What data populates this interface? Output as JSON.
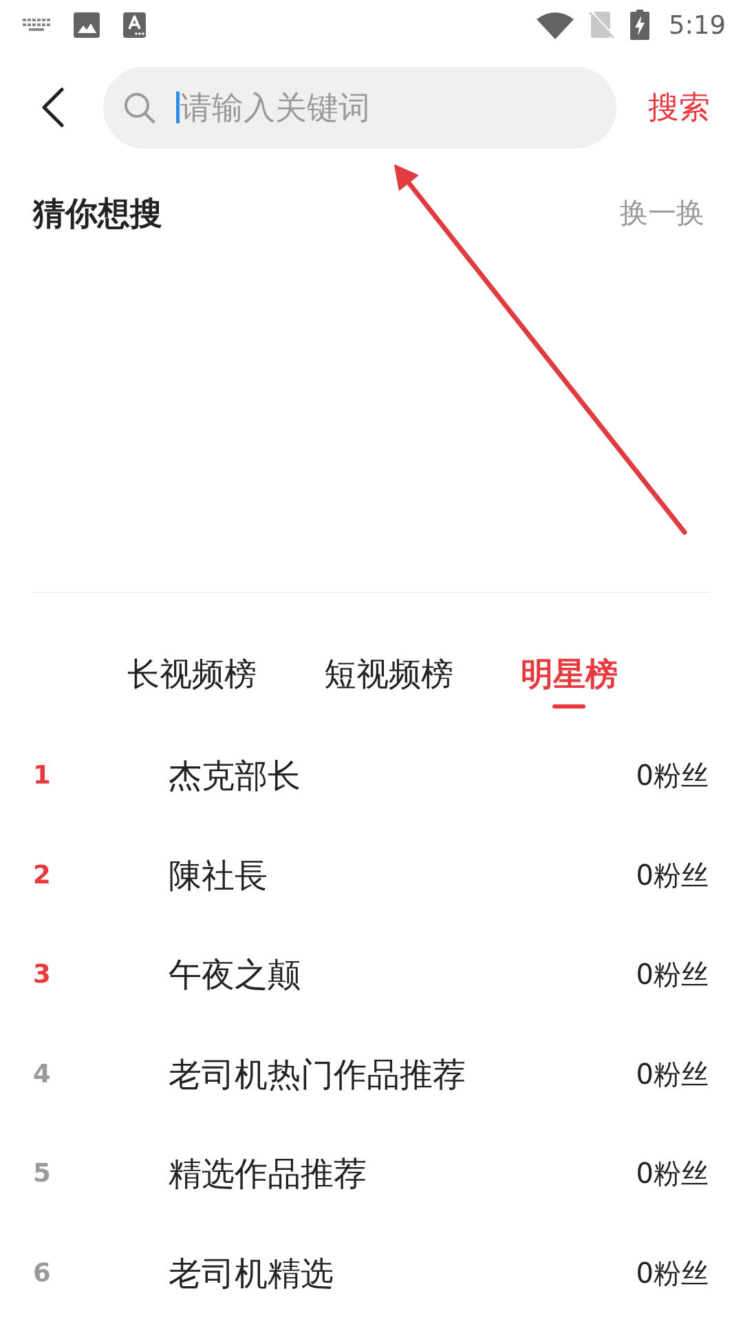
{
  "status_bar": {
    "time": "5:19"
  },
  "header": {
    "search": {
      "placeholder": "请输入关键词",
      "focused": true
    },
    "search_button": "搜索"
  },
  "suggestions": {
    "title": "猜你想搜",
    "refresh": "换一换"
  },
  "tabs": [
    {
      "label": "长视频榜",
      "selected": false
    },
    {
      "label": "短视频榜",
      "selected": false
    },
    {
      "label": "明星榜",
      "selected": true
    }
  ],
  "ranking": [
    {
      "rank": "1",
      "name": "杰克部长",
      "fans": "0粉丝",
      "top": true
    },
    {
      "rank": "2",
      "name": "陳社長",
      "fans": "0粉丝",
      "top": true
    },
    {
      "rank": "3",
      "name": "午夜之颠",
      "fans": "0粉丝",
      "top": true
    },
    {
      "rank": "4",
      "name": "老司机热门作品推荐",
      "fans": "0粉丝",
      "top": false
    },
    {
      "rank": "5",
      "name": "精选作品推荐",
      "fans": "0粉丝",
      "top": false
    },
    {
      "rank": "6",
      "name": "老司机精选",
      "fans": "0粉丝",
      "top": false
    }
  ]
}
